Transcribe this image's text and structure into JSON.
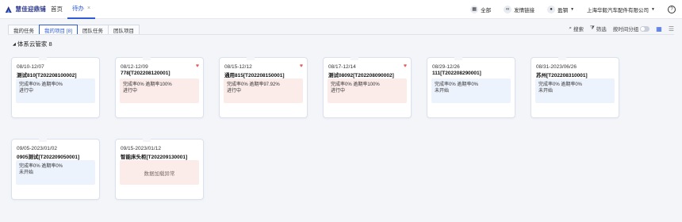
{
  "header": {
    "logo_text": "慧佳迎鼎铺",
    "tabs": [
      {
        "label": "首页",
        "active": false
      },
      {
        "label": "待办",
        "active": true
      }
    ],
    "tab_close": "×",
    "right": [
      {
        "label": "全部",
        "icon": "grid-icon"
      },
      {
        "label": "发情链接",
        "icon": "link-icon"
      },
      {
        "label": "盈钢",
        "icon": "user-icon",
        "caret": "▼"
      },
      {
        "label": "上海华毅汽车配件有限公司",
        "icon": "",
        "caret": "▼"
      },
      {
        "label": "",
        "icon": "help-icon"
      }
    ]
  },
  "subtabs": [
    {
      "label": "我的任务",
      "active": false
    },
    {
      "label": "我的项目 [8]",
      "active": true
    },
    {
      "label": "团队任务",
      "active": false
    },
    {
      "label": "团队项目",
      "active": false
    }
  ],
  "tools": {
    "search": "搜索",
    "filter": "筛选",
    "group": "按时间分组"
  },
  "section": {
    "title": "体系云管家 8"
  },
  "colors": {
    "accent": "#2f5bd9",
    "blue_box": "#edf3fd",
    "pink_box": "#fcece9",
    "heart": "#e35b5b"
  },
  "cards": [
    {
      "date": "08/10-12/07",
      "name": "测试810[T202208100002]",
      "heart": false,
      "tone": "blue",
      "line1": "完成率0% 逾期率0%",
      "line2": "进行中"
    },
    {
      "date": "08/12-12/09",
      "name": "778[T202208120001]",
      "heart": true,
      "tone": "pink",
      "line1": "完成率0% 逾期率100%",
      "line2": "进行中"
    },
    {
      "date": "08/15-12/12",
      "name": "通用815[T202208150001]",
      "heart": true,
      "tone": "pink",
      "line1": "完成率0% 逾期率97.92%",
      "line2": "进行中"
    },
    {
      "date": "08/17-12/14",
      "name": "测试08092[T202208090002]",
      "heart": true,
      "tone": "pink",
      "line1": "完成率0% 逾期率100%",
      "line2": "进行中"
    },
    {
      "date": "08/29-12/26",
      "name": "111[T202208290001]",
      "heart": false,
      "tone": "blue",
      "line1": "完成率0% 逾期率0%",
      "line2": "未开始"
    },
    {
      "date": "08/31-2023/06/26",
      "name": "苏州[T202208310001]",
      "heart": false,
      "tone": "blue",
      "line1": "完成率0% 逾期率0%",
      "line2": "未开始"
    },
    {
      "date": "09/05-2023/01/02",
      "name": "0905测试[T202209050001]",
      "heart": false,
      "tone": "blue",
      "line1": "完成率0% 逾期率0%",
      "line2": "未开始"
    },
    {
      "date": "09/15-2023/01/12",
      "name": "智能床头柜[T202209130001]",
      "heart": false,
      "tone": "error",
      "error": "数据加载异常"
    }
  ]
}
